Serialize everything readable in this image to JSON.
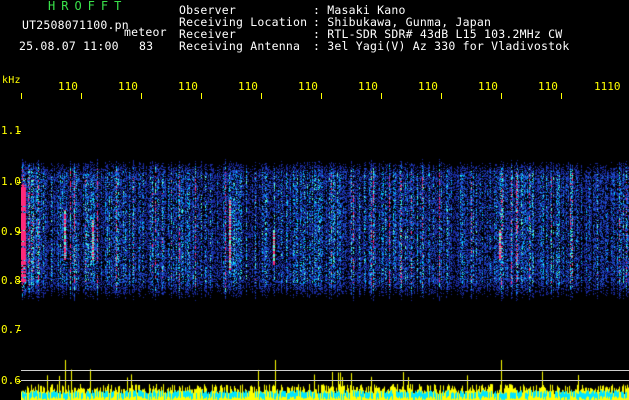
{
  "header": {
    "app_logo": "HROFFT",
    "file_name": "UT2508071100.pn",
    "meteor_label": "meteor",
    "date_time": "25.08.07 11:00",
    "count": "83",
    "info": [
      {
        "label": "Observer",
        "value": ": Masaki Kano"
      },
      {
        "label": "Receiving Location",
        "value": ": Shibukawa, Gunma, Japan"
      },
      {
        "label": "Receiver",
        "value": ": RTL-SDR SDR# 43dB L15 103.2MHz CW"
      },
      {
        "label": "Receiving Antenna",
        "value": ": 3el Yagi(V) Az 330 for Vladivostok"
      }
    ]
  },
  "axes": {
    "y_unit": "kHz",
    "y_ticks": [
      "1.1",
      "1.0",
      "0.9",
      "0.8",
      "0.7",
      "0.6"
    ],
    "x_ticks": [
      "110",
      "110",
      "110",
      "110",
      "110",
      "110",
      "110",
      "110",
      "110",
      "1110"
    ]
  },
  "colors": {
    "text": "#ffffff",
    "logo": "#39e24a",
    "axis": "#ffff00",
    "background": "#000000",
    "signal_low": "#1a2a9e",
    "signal_mid": "#00c8ff",
    "signal_high": "#ff2a7a",
    "power_bars": "#ffff00",
    "power_base": "#00e5ff"
  }
}
